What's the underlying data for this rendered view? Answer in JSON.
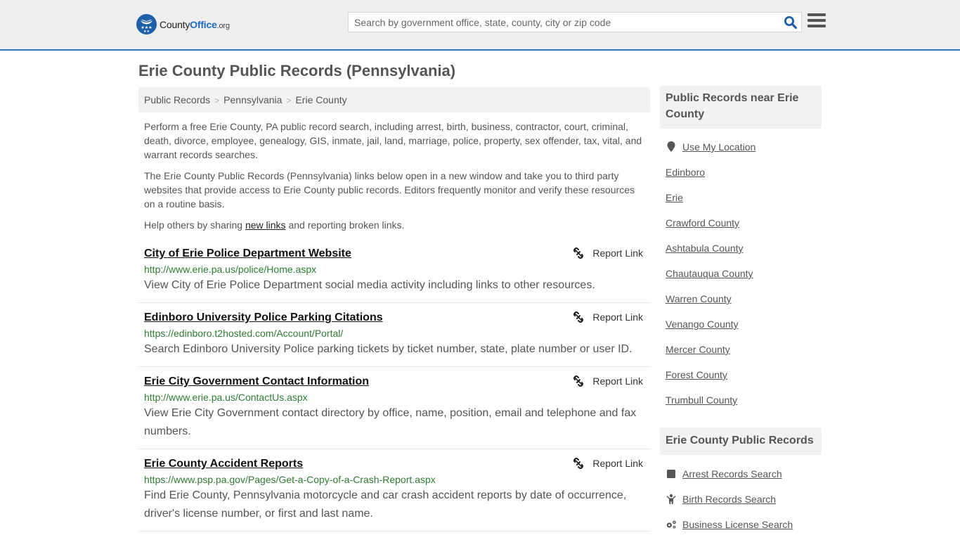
{
  "header": {
    "logo": {
      "brand_part1": "County",
      "brand_part2": "Office",
      "brand_suffix": ".org"
    },
    "search": {
      "placeholder": "Search by government office, state, county, city or zip code",
      "value": ""
    },
    "icons": {
      "search": "search-icon",
      "menu": "hamburger-menu-icon"
    }
  },
  "page": {
    "title": "Erie County Public Records (Pennsylvania)",
    "breadcrumb": [
      "Public Records",
      "Pennsylvania",
      "Erie County"
    ],
    "intro_1": "Perform a free Erie County, PA public record search, including arrest, birth, business, contractor, court, criminal, death, divorce, employee, genealogy, GIS, inmate, jail, land, marriage, police, property, sex offender, tax, vital, and warrant records searches.",
    "intro_2": "The Erie County Public Records (Pennsylvania) links below open in a new window and take you to third party websites that provide access to Erie County public records. Editors frequently monitor and verify these resources on a routine basis.",
    "help": {
      "before": "Help others by sharing ",
      "link": "new links",
      "after": " and reporting broken links."
    }
  },
  "records": [
    {
      "title": "City of Erie Police Department Website",
      "url": "http://www.erie.pa.us/police/Home.aspx",
      "description": "View City of Erie Police Department social media activity including links to other resources.",
      "report_label": "Report Link"
    },
    {
      "title": "Edinboro University Police Parking Citations",
      "url": "https://edinboro.t2hosted.com/Account/Portal/",
      "description": "Search Edinboro University Police parking tickets by ticket number, state, plate number or user ID.",
      "report_label": "Report Link"
    },
    {
      "title": "Erie City Government Contact Information",
      "url": "http://www.erie.pa.us/ContactUs.aspx",
      "description": "View Erie City Government contact directory by office, name, position, email and telephone and fax numbers.",
      "report_label": "Report Link"
    },
    {
      "title": "Erie County Accident Reports",
      "url": "https://www.psp.pa.gov/Pages/Get-a-Copy-of-a-Crash-Report.aspx",
      "description": "Find Erie County, Pennsylvania motorcycle and car crash accident reports by date of occurrence, driver's license number, or first and last name.",
      "report_label": "Report Link"
    }
  ],
  "sidebar": {
    "nearby": {
      "heading": "Public Records near Erie County",
      "use_location": "Use My Location",
      "items": [
        "Edinboro",
        "Erie",
        "Crawford County",
        "Ashtabula County",
        "Chautauqua County",
        "Warren County",
        "Venango County",
        "Mercer County",
        "Forest County",
        "Trumbull County"
      ]
    },
    "county_records": {
      "heading": "Erie County Public Records",
      "items": [
        {
          "label": "Arrest Records Search",
          "icon": "square-icon"
        },
        {
          "label": "Birth Records Search",
          "icon": "child-icon"
        },
        {
          "label": "Business License Search",
          "icon": "gears-icon"
        }
      ]
    }
  },
  "colors": {
    "accent_border": "#337ab7",
    "brand_blue": "#1d5fa8",
    "url_green": "#2e7d32",
    "header_bg": "#eeeeee",
    "panel_bg": "#f2f2f2"
  }
}
